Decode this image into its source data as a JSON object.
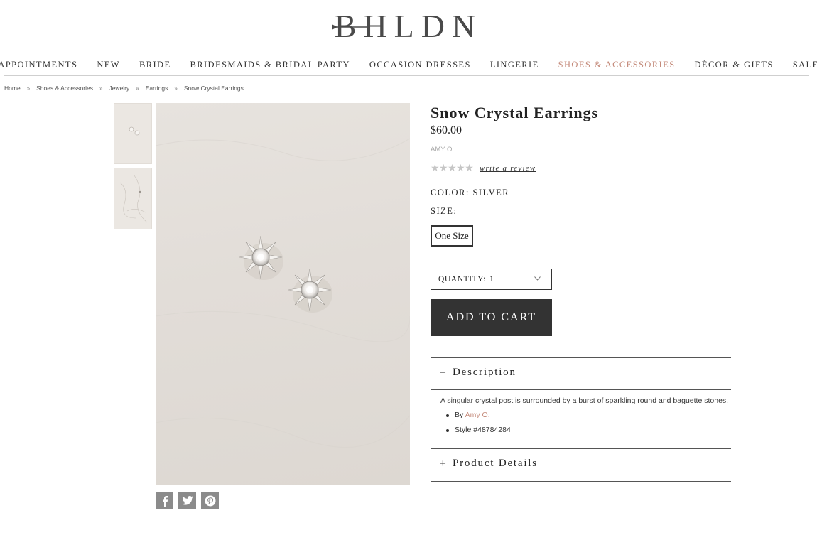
{
  "brand": {
    "logo_text": "BHLDN"
  },
  "nav": {
    "items": [
      {
        "label": "APPOINTMENTS",
        "active": false
      },
      {
        "label": "NEW",
        "active": false
      },
      {
        "label": "BRIDE",
        "active": false
      },
      {
        "label": "BRIDESMAIDS & BRIDAL PARTY",
        "active": false
      },
      {
        "label": "OCCASION DRESSES",
        "active": false
      },
      {
        "label": "LINGERIE",
        "active": false
      },
      {
        "label": "SHOES & ACCESSORIES",
        "active": true
      },
      {
        "label": "DÉCOR & GIFTS",
        "active": false
      },
      {
        "label": "SALE",
        "active": false
      }
    ],
    "active_color": "#c48a7a"
  },
  "breadcrumb": {
    "items": [
      "Home",
      "Shoes & Accessories",
      "Jewelry",
      "Earrings",
      "Snow Crystal Earrings"
    ],
    "separator": "»"
  },
  "product": {
    "title": "Snow Crystal Earrings",
    "price": "$60.00",
    "designer": "AMY O.",
    "rating_stars": "★★★★★",
    "rating_value": 0,
    "review_link": "write a review",
    "color_line": "COLOR: SILVER",
    "size_label": "SIZE:",
    "size_option": "One Size",
    "quantity_label": "QUANTITY:",
    "quantity_value": "1",
    "add_to_cart": "ADD TO CART"
  },
  "accordion": {
    "description_toggle": "−",
    "description_title": "Description",
    "description_text": "A singular crystal post is surrounded by a burst of sparkling round and baguette stones.",
    "by_prefix": "By",
    "by_designer": "Amy O.",
    "style_text": "Style #48784284",
    "details_toggle": "+",
    "details_title": "Product Details"
  },
  "social": {
    "icons": [
      "facebook-icon",
      "twitter-icon",
      "pinterest-icon"
    ]
  },
  "colors": {
    "accent": "#c48a7a",
    "button_bg": "#333333",
    "image_bg": "#e2ddd8",
    "social_bg": "#8b8b8b"
  }
}
